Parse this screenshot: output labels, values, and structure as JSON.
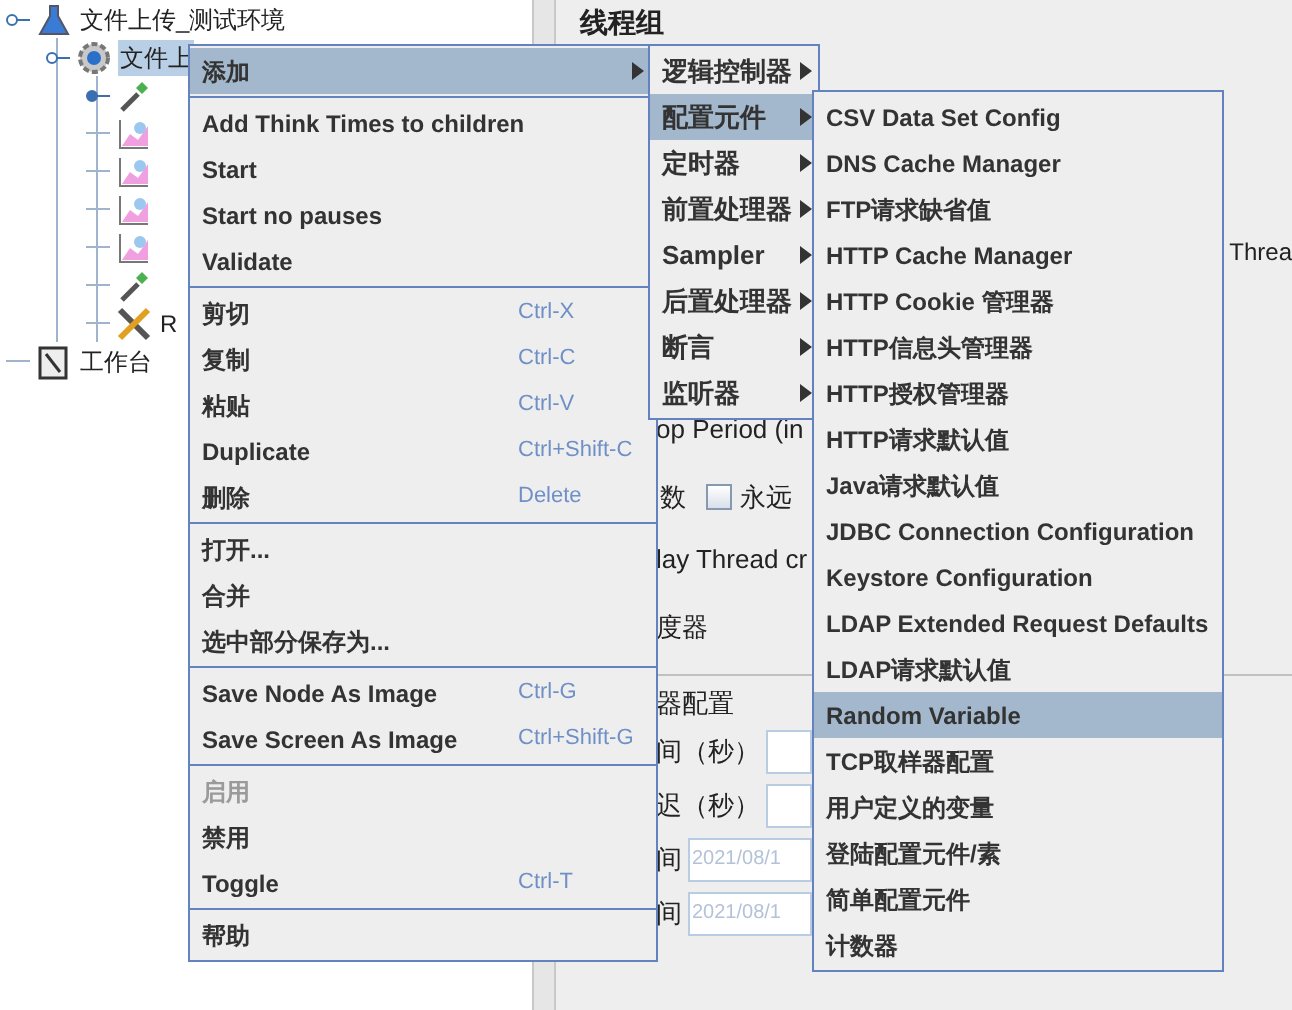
{
  "tree": [
    {
      "label": "文件上传_测试环境",
      "kind": "flask",
      "expanded": true,
      "selected": false,
      "children": [
        {
          "label": "文件上",
          "kind": "gear",
          "expanded": true,
          "selected": true,
          "children": [
            {
              "kind": "dropper",
              "expanded": false
            },
            {
              "kind": "chart"
            },
            {
              "kind": "chart"
            },
            {
              "kind": "chart"
            },
            {
              "kind": "chart"
            },
            {
              "kind": "dropper"
            },
            {
              "label": "R",
              "kind": "tools",
              "selected": false
            }
          ]
        }
      ]
    },
    {
      "label": "工作台",
      "kind": "notebook",
      "selected": false
    }
  ],
  "panel": {
    "title": "线程组",
    "thread_label": "Threa",
    "ramp_label": "op Period (in",
    "loop_label": "数",
    "forever": {
      "label": "永远",
      "checked": false
    },
    "delay_label": "lay Thread cr",
    "scheduler_label": "度器",
    "group_title": "器配置",
    "fields": [
      {
        "label": "间（秒）",
        "kind": "input"
      },
      {
        "label": "迟（秒）",
        "kind": "input"
      },
      {
        "label": "间",
        "kind": "date",
        "placeholder": "2021/08/1"
      },
      {
        "label": "间",
        "kind": "date",
        "placeholder": "2021/08/1"
      }
    ]
  },
  "context_menu": {
    "groups": [
      [
        {
          "label": "添加",
          "submenu": true,
          "selected": true,
          "disabled": false
        }
      ],
      [
        {
          "label": "Add Think Times to children",
          "selected": false,
          "disabled": false
        },
        {
          "label": "Start",
          "selected": false,
          "disabled": false
        },
        {
          "label": "Start no pauses",
          "selected": false,
          "disabled": false
        },
        {
          "label": "Validate",
          "selected": false,
          "disabled": false
        }
      ],
      [
        {
          "label": "剪切",
          "shortcut": "Ctrl-X",
          "selected": false,
          "disabled": false
        },
        {
          "label": "复制",
          "shortcut": "Ctrl-C",
          "selected": false,
          "disabled": false
        },
        {
          "label": "粘贴",
          "shortcut": "Ctrl-V",
          "selected": false,
          "disabled": false
        },
        {
          "label": "Duplicate",
          "shortcut": "Ctrl+Shift-C",
          "selected": false,
          "disabled": false
        },
        {
          "label": "删除",
          "shortcut": "Delete",
          "selected": false,
          "disabled": false
        }
      ],
      [
        {
          "label": "打开...",
          "selected": false,
          "disabled": false
        },
        {
          "label": "合并",
          "selected": false,
          "disabled": false
        },
        {
          "label": "选中部分保存为...",
          "selected": false,
          "disabled": false
        }
      ],
      [
        {
          "label": "Save Node As Image",
          "shortcut": "Ctrl-G",
          "selected": false,
          "disabled": false
        },
        {
          "label": "Save Screen As Image",
          "shortcut": "Ctrl+Shift-G",
          "selected": false,
          "disabled": false
        }
      ],
      [
        {
          "label": "启用",
          "selected": false,
          "disabled": true
        },
        {
          "label": "禁用",
          "selected": false,
          "disabled": false
        },
        {
          "label": "Toggle",
          "shortcut": "Ctrl-T",
          "selected": false,
          "disabled": false
        }
      ],
      [
        {
          "label": "帮助",
          "selected": false,
          "disabled": false
        }
      ]
    ]
  },
  "add_menu": [
    {
      "label": "逻辑控制器",
      "selected": false
    },
    {
      "label": "配置元件",
      "selected": true
    },
    {
      "label": "定时器",
      "selected": false
    },
    {
      "label": "前置处理器",
      "selected": false
    },
    {
      "label": "Sampler",
      "selected": false
    },
    {
      "label": "后置处理器",
      "selected": false
    },
    {
      "label": "断言",
      "selected": false
    },
    {
      "label": "监听器",
      "selected": false
    }
  ],
  "config_menu": [
    {
      "label": "CSV Data Set Config",
      "selected": false
    },
    {
      "label": "DNS Cache Manager",
      "selected": false
    },
    {
      "label": "FTP请求缺省值",
      "selected": false
    },
    {
      "label": "HTTP Cache Manager",
      "selected": false
    },
    {
      "label": "HTTP Cookie 管理器",
      "selected": false
    },
    {
      "label": "HTTP信息头管理器",
      "selected": false
    },
    {
      "label": "HTTP授权管理器",
      "selected": false
    },
    {
      "label": "HTTP请求默认值",
      "selected": false
    },
    {
      "label": "Java请求默认值",
      "selected": false
    },
    {
      "label": "JDBC Connection Configuration",
      "selected": false
    },
    {
      "label": "Keystore Configuration",
      "selected": false
    },
    {
      "label": "LDAP Extended Request Defaults",
      "selected": false
    },
    {
      "label": "LDAP请求默认值",
      "selected": false
    },
    {
      "label": "Random Variable",
      "selected": true
    },
    {
      "label": "TCP取样器配置",
      "selected": false
    },
    {
      "label": "用户定义的变量",
      "selected": false
    },
    {
      "label": "登陆配置元件/素",
      "selected": false
    },
    {
      "label": "简单配置元件",
      "selected": false
    },
    {
      "label": "计数器",
      "selected": false
    }
  ]
}
